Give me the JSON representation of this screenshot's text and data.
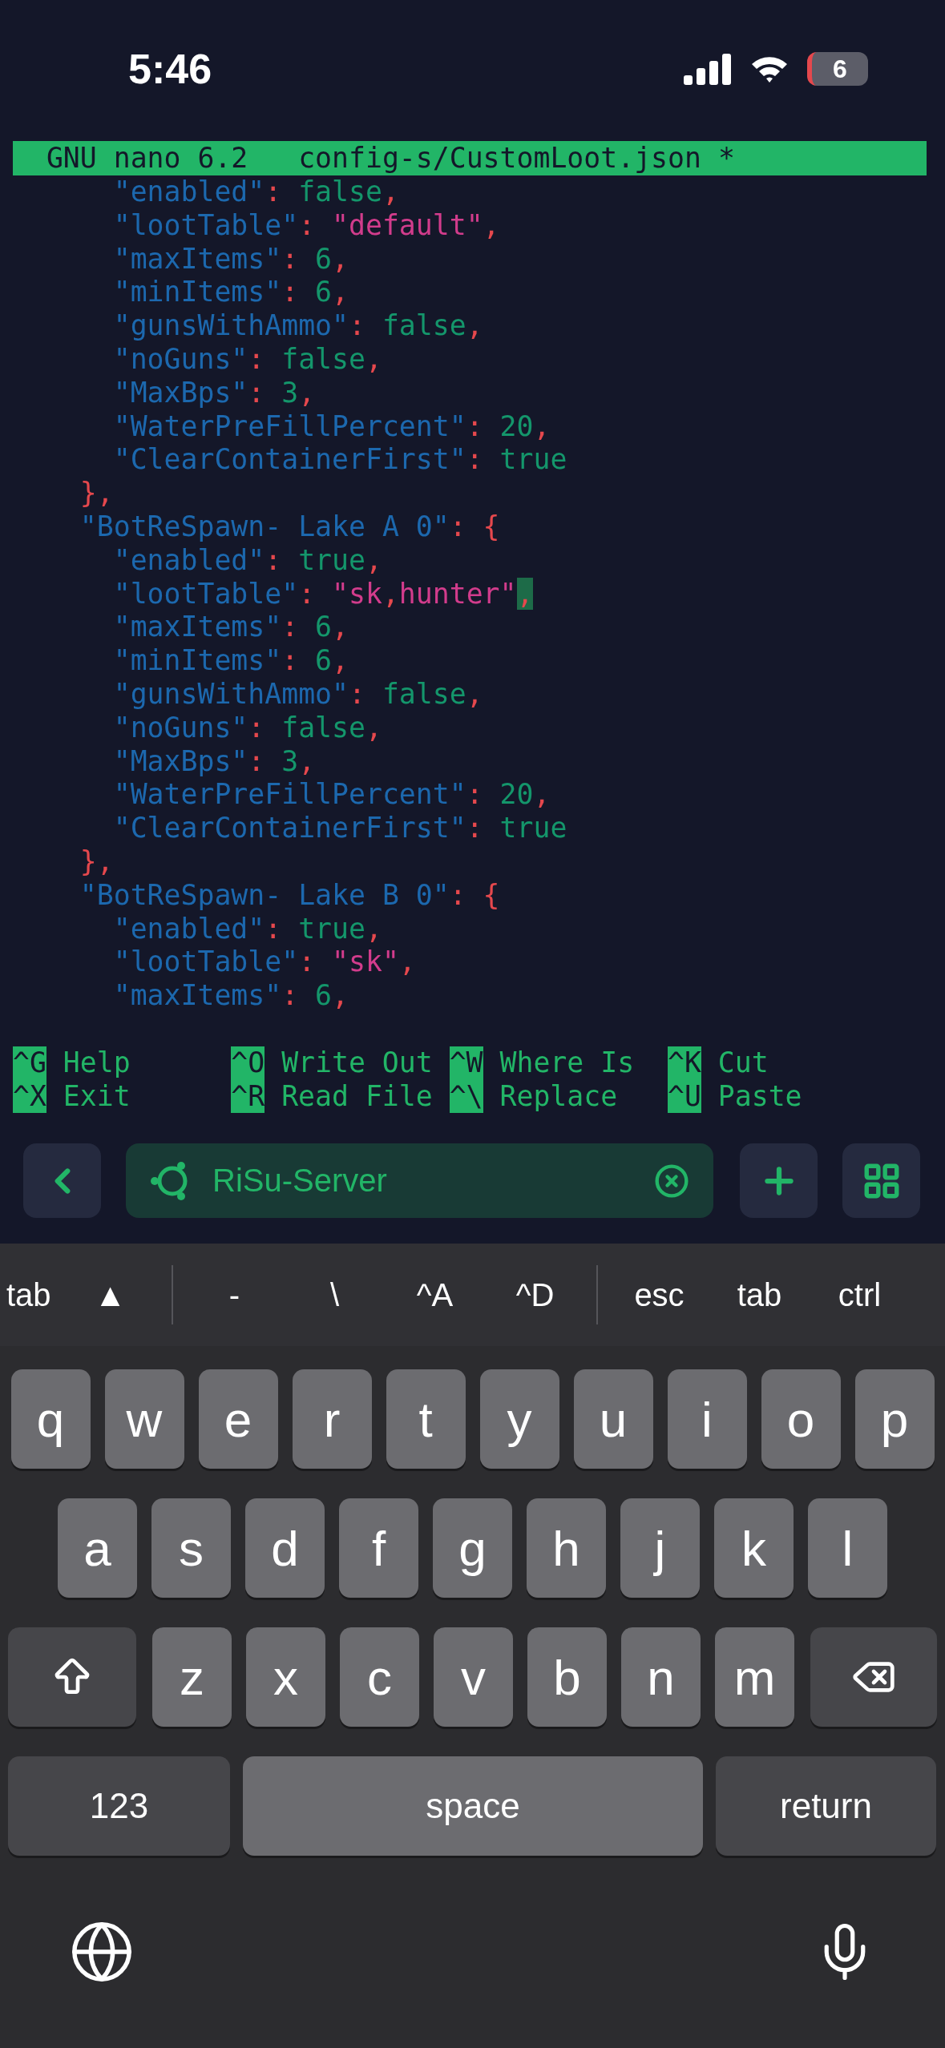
{
  "status_bar": {
    "time": "5:46",
    "battery": "6"
  },
  "editor": {
    "app": "GNU nano 6.2",
    "file": "config-s/CustomLoot.json *",
    "lines": [
      {
        "kind": "member",
        "tokens": [
          {
            "kind": "key",
            "text": "\"enabled\""
          },
          {
            "kind": "punct",
            "text": ": "
          },
          {
            "kind": "literal",
            "text": "false"
          },
          {
            "kind": "punct",
            "text": ","
          }
        ]
      },
      {
        "kind": "member",
        "tokens": [
          {
            "kind": "key",
            "text": "\"lootTable\""
          },
          {
            "kind": "punct",
            "text": ": "
          },
          {
            "kind": "string",
            "text": "\"default\""
          },
          {
            "kind": "punct",
            "text": ","
          }
        ]
      },
      {
        "kind": "member",
        "tokens": [
          {
            "kind": "key",
            "text": "\"maxItems\""
          },
          {
            "kind": "punct",
            "text": ": "
          },
          {
            "kind": "literal",
            "text": "6"
          },
          {
            "kind": "punct",
            "text": ","
          }
        ]
      },
      {
        "kind": "member",
        "tokens": [
          {
            "kind": "key",
            "text": "\"minItems\""
          },
          {
            "kind": "punct",
            "text": ": "
          },
          {
            "kind": "literal",
            "text": "6"
          },
          {
            "kind": "punct",
            "text": ","
          }
        ]
      },
      {
        "kind": "member",
        "tokens": [
          {
            "kind": "key",
            "text": "\"gunsWithAmmo\""
          },
          {
            "kind": "punct",
            "text": ": "
          },
          {
            "kind": "literal",
            "text": "false"
          },
          {
            "kind": "punct",
            "text": ","
          }
        ]
      },
      {
        "kind": "member",
        "tokens": [
          {
            "kind": "key",
            "text": "\"noGuns\""
          },
          {
            "kind": "punct",
            "text": ": "
          },
          {
            "kind": "literal",
            "text": "false"
          },
          {
            "kind": "punct",
            "text": ","
          }
        ]
      },
      {
        "kind": "member",
        "tokens": [
          {
            "kind": "key",
            "text": "\"MaxBps\""
          },
          {
            "kind": "punct",
            "text": ": "
          },
          {
            "kind": "literal",
            "text": "3"
          },
          {
            "kind": "punct",
            "text": ","
          }
        ]
      },
      {
        "kind": "member",
        "tokens": [
          {
            "kind": "key",
            "text": "\"WaterPreFillPercent\""
          },
          {
            "kind": "punct",
            "text": ": "
          },
          {
            "kind": "literal",
            "text": "20"
          },
          {
            "kind": "punct",
            "text": ","
          }
        ]
      },
      {
        "kind": "member",
        "tokens": [
          {
            "kind": "key",
            "text": "\"ClearContainerFirst\""
          },
          {
            "kind": "punct",
            "text": ": "
          },
          {
            "kind": "literal",
            "text": "true"
          }
        ]
      },
      {
        "kind": "entry",
        "tokens": [
          {
            "kind": "punct",
            "text": "},"
          }
        ]
      },
      {
        "kind": "entry",
        "tokens": [
          {
            "kind": "key",
            "text": "\"BotReSpawn- Lake A 0\""
          },
          {
            "kind": "punct",
            "text": ": {"
          }
        ]
      },
      {
        "kind": "member",
        "tokens": [
          {
            "kind": "key",
            "text": "\"enabled\""
          },
          {
            "kind": "punct",
            "text": ": "
          },
          {
            "kind": "literal",
            "text": "true"
          },
          {
            "kind": "punct",
            "text": ","
          }
        ]
      },
      {
        "kind": "member",
        "tokens": [
          {
            "kind": "key",
            "text": "\"lootTable\""
          },
          {
            "kind": "punct",
            "text": ": "
          },
          {
            "kind": "string",
            "text": "\"sk"
          },
          {
            "kind": "punct",
            "text": ","
          },
          {
            "kind": "string",
            "text": "hunter\""
          },
          {
            "kind": "punct",
            "text": ",",
            "cursor": true
          }
        ]
      },
      {
        "kind": "member",
        "tokens": [
          {
            "kind": "key",
            "text": "\"maxItems\""
          },
          {
            "kind": "punct",
            "text": ": "
          },
          {
            "kind": "literal",
            "text": "6"
          },
          {
            "kind": "punct",
            "text": ","
          }
        ]
      },
      {
        "kind": "member",
        "tokens": [
          {
            "kind": "key",
            "text": "\"minItems\""
          },
          {
            "kind": "punct",
            "text": ": "
          },
          {
            "kind": "literal",
            "text": "6"
          },
          {
            "kind": "punct",
            "text": ","
          }
        ]
      },
      {
        "kind": "member",
        "tokens": [
          {
            "kind": "key",
            "text": "\"gunsWithAmmo\""
          },
          {
            "kind": "punct",
            "text": ": "
          },
          {
            "kind": "literal",
            "text": "false"
          },
          {
            "kind": "punct",
            "text": ","
          }
        ]
      },
      {
        "kind": "member",
        "tokens": [
          {
            "kind": "key",
            "text": "\"noGuns\""
          },
          {
            "kind": "punct",
            "text": ": "
          },
          {
            "kind": "literal",
            "text": "false"
          },
          {
            "kind": "punct",
            "text": ","
          }
        ]
      },
      {
        "kind": "member",
        "tokens": [
          {
            "kind": "key",
            "text": "\"MaxBps\""
          },
          {
            "kind": "punct",
            "text": ": "
          },
          {
            "kind": "literal",
            "text": "3"
          },
          {
            "kind": "punct",
            "text": ","
          }
        ]
      },
      {
        "kind": "member",
        "tokens": [
          {
            "kind": "key",
            "text": "\"WaterPreFillPercent\""
          },
          {
            "kind": "punct",
            "text": ": "
          },
          {
            "kind": "literal",
            "text": "20"
          },
          {
            "kind": "punct",
            "text": ","
          }
        ]
      },
      {
        "kind": "member",
        "tokens": [
          {
            "kind": "key",
            "text": "\"ClearContainerFirst\""
          },
          {
            "kind": "punct",
            "text": ": "
          },
          {
            "kind": "literal",
            "text": "true"
          }
        ]
      },
      {
        "kind": "entry",
        "tokens": [
          {
            "kind": "punct",
            "text": "},"
          }
        ]
      },
      {
        "kind": "entry",
        "tokens": [
          {
            "kind": "key",
            "text": "\"BotReSpawn- Lake B 0\""
          },
          {
            "kind": "punct",
            "text": ": {"
          }
        ]
      },
      {
        "kind": "member",
        "tokens": [
          {
            "kind": "key",
            "text": "\"enabled\""
          },
          {
            "kind": "punct",
            "text": ": "
          },
          {
            "kind": "literal",
            "text": "true"
          },
          {
            "kind": "punct",
            "text": ","
          }
        ]
      },
      {
        "kind": "member",
        "tokens": [
          {
            "kind": "key",
            "text": "\"lootTable\""
          },
          {
            "kind": "punct",
            "text": ": "
          },
          {
            "kind": "string",
            "text": "\"sk\""
          },
          {
            "kind": "punct",
            "text": ","
          }
        ]
      },
      {
        "kind": "member",
        "tokens": [
          {
            "kind": "key",
            "text": "\"maxItems\""
          },
          {
            "kind": "punct",
            "text": ": "
          },
          {
            "kind": "literal",
            "text": "6"
          },
          {
            "kind": "punct",
            "text": ","
          }
        ]
      }
    ],
    "shortcuts": [
      [
        {
          "key": "^G",
          "label": "Help"
        },
        {
          "key": "^O",
          "label": "Write Out"
        },
        {
          "key": "^W",
          "label": "Where Is"
        },
        {
          "key": "^K",
          "label": "Cut"
        }
      ],
      [
        {
          "key": "^X",
          "label": "Exit"
        },
        {
          "key": "^R",
          "label": "Read File"
        },
        {
          "key": "^\\",
          "label": "Replace"
        },
        {
          "key": "^U",
          "label": "Paste"
        }
      ]
    ]
  },
  "session_bar": {
    "session": "RiSu-Server"
  },
  "keyboard": {
    "accessory": [
      {
        "kind": "key",
        "label": "tab"
      },
      {
        "kind": "key",
        "label": "▲"
      },
      {
        "kind": "separator"
      },
      {
        "kind": "key",
        "label": "-"
      },
      {
        "kind": "key",
        "label": "\\"
      },
      {
        "kind": "key",
        "label": "^A"
      },
      {
        "kind": "key",
        "label": "^D"
      },
      {
        "kind": "separator"
      },
      {
        "kind": "key",
        "label": "esc"
      },
      {
        "kind": "key",
        "label": "tab"
      },
      {
        "kind": "key",
        "label": "ctrl"
      }
    ],
    "letter_rows": [
      [
        "q",
        "w",
        "e",
        "r",
        "t",
        "y",
        "u",
        "i",
        "o",
        "p"
      ],
      [
        "a",
        "s",
        "d",
        "f",
        "g",
        "h",
        "j",
        "k",
        "l"
      ],
      [
        "z",
        "x",
        "c",
        "v",
        "b",
        "n",
        "m"
      ]
    ],
    "bottom_row": [
      "123",
      "space",
      "return"
    ]
  }
}
